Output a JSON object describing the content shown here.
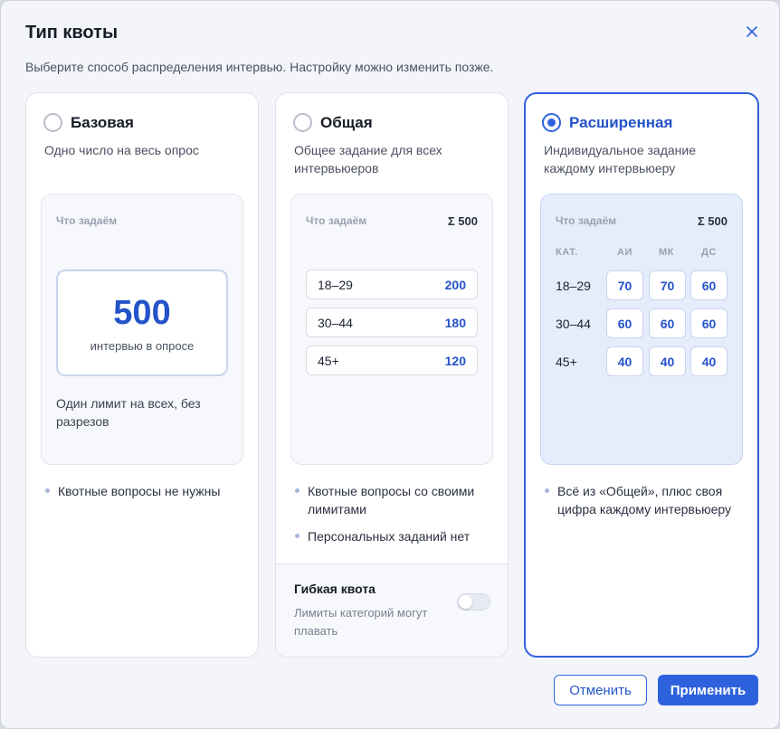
{
  "dialog": {
    "title": "Тип квоты",
    "subtitle": "Выберите способ распределения интервью. Настройку можно изменить позже."
  },
  "cards": {
    "basic": {
      "name": "Базовая",
      "description": "Одно число на весь опрос",
      "panel_label": "Что задаём",
      "total": "500",
      "total_caption": "интервью в опросе",
      "note": "Один лимит на всех, без разрезов",
      "bullets": [
        "Квотные вопросы не нужны"
      ],
      "selected": false
    },
    "general": {
      "name": "Общая",
      "description": "Общее задание для всех интервьюеров",
      "panel_label": "Что задаём",
      "panel_sum": "Σ 500",
      "rows": [
        {
          "label": "18–29",
          "value": "200"
        },
        {
          "label": "30–44",
          "value": "180"
        },
        {
          "label": "45+",
          "value": "120"
        }
      ],
      "bullets": [
        "Квотные вопросы со своими лимитами",
        "Персональных заданий нет"
      ],
      "flex_title": "Гибкая квота",
      "flex_desc": "Лимиты категорий могут плавать",
      "flex_enabled": false,
      "selected": false
    },
    "extended": {
      "name": "Расширенная",
      "description": "Индивидуальное задание каждому интервьюеру",
      "panel_label": "Что задаём",
      "panel_sum": "Σ 500",
      "grid_header": [
        "КАТ.",
        "АИ",
        "МК",
        "ДС"
      ],
      "grid_rows": [
        {
          "label": "18–29",
          "values": [
            "70",
            "70",
            "60"
          ]
        },
        {
          "label": "30–44",
          "values": [
            "60",
            "60",
            "60"
          ]
        },
        {
          "label": "45+",
          "values": [
            "40",
            "40",
            "40"
          ]
        }
      ],
      "bullets": [
        "Всё из «Общей», плюс своя цифра каждому интервьюеру"
      ],
      "selected": true
    }
  },
  "actions": {
    "cancel_label": "Отменить",
    "apply_label": "Применить"
  },
  "colors": {
    "accent": "#2e62dd",
    "accent_text": "#2453c9",
    "selected_panel_bg": "#e5ecfb"
  },
  "icons": {
    "close": "close-icon"
  }
}
